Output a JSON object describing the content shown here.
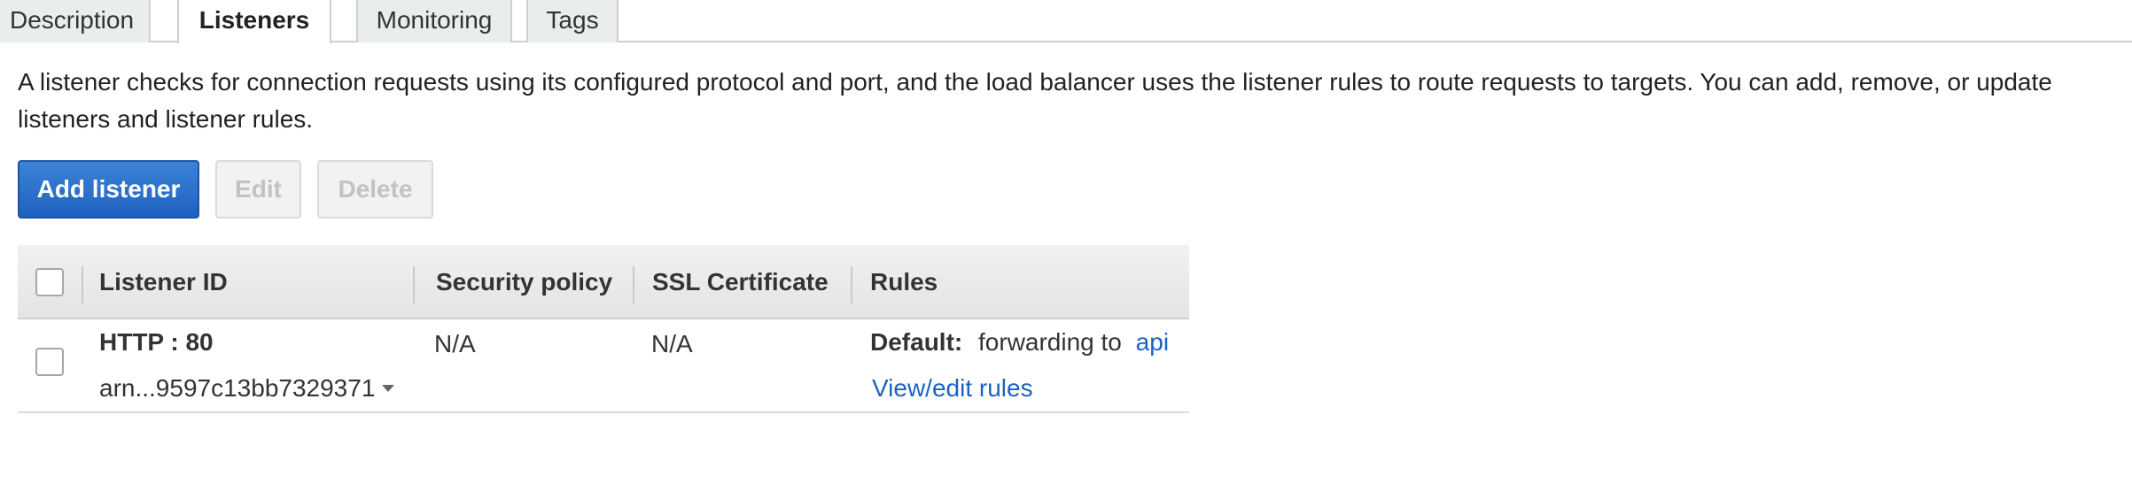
{
  "tabs": [
    {
      "label": "Description"
    },
    {
      "label": "Listeners"
    },
    {
      "label": "Monitoring"
    },
    {
      "label": "Tags"
    }
  ],
  "active_tab": "Listeners",
  "intro_text": "A listener checks for connection requests using its configured protocol and port, and the load balancer uses the listener rules to route requests to targets. You can add, remove, or update listeners and listener rules.",
  "toolbar": {
    "add_label": "Add listener",
    "edit_label": "Edit",
    "delete_label": "Delete"
  },
  "table": {
    "columns": [
      "Listener ID",
      "Security policy",
      "SSL Certificate",
      "Rules"
    ],
    "rows": [
      {
        "listener_id": "HTTP : 80",
        "arn": "arn...9597c13bb7329371",
        "security_policy": "N/A",
        "ssl_certificate": "N/A",
        "rules_default_label": "Default:",
        "rules_default_text": "forwarding to",
        "rules_target_link": "api",
        "rules_view_link": "View/edit rules"
      }
    ]
  },
  "colors": {
    "primary_button": "#1e62c0",
    "link": "#1a63c2",
    "disabled_text": "#c2c2c2"
  }
}
